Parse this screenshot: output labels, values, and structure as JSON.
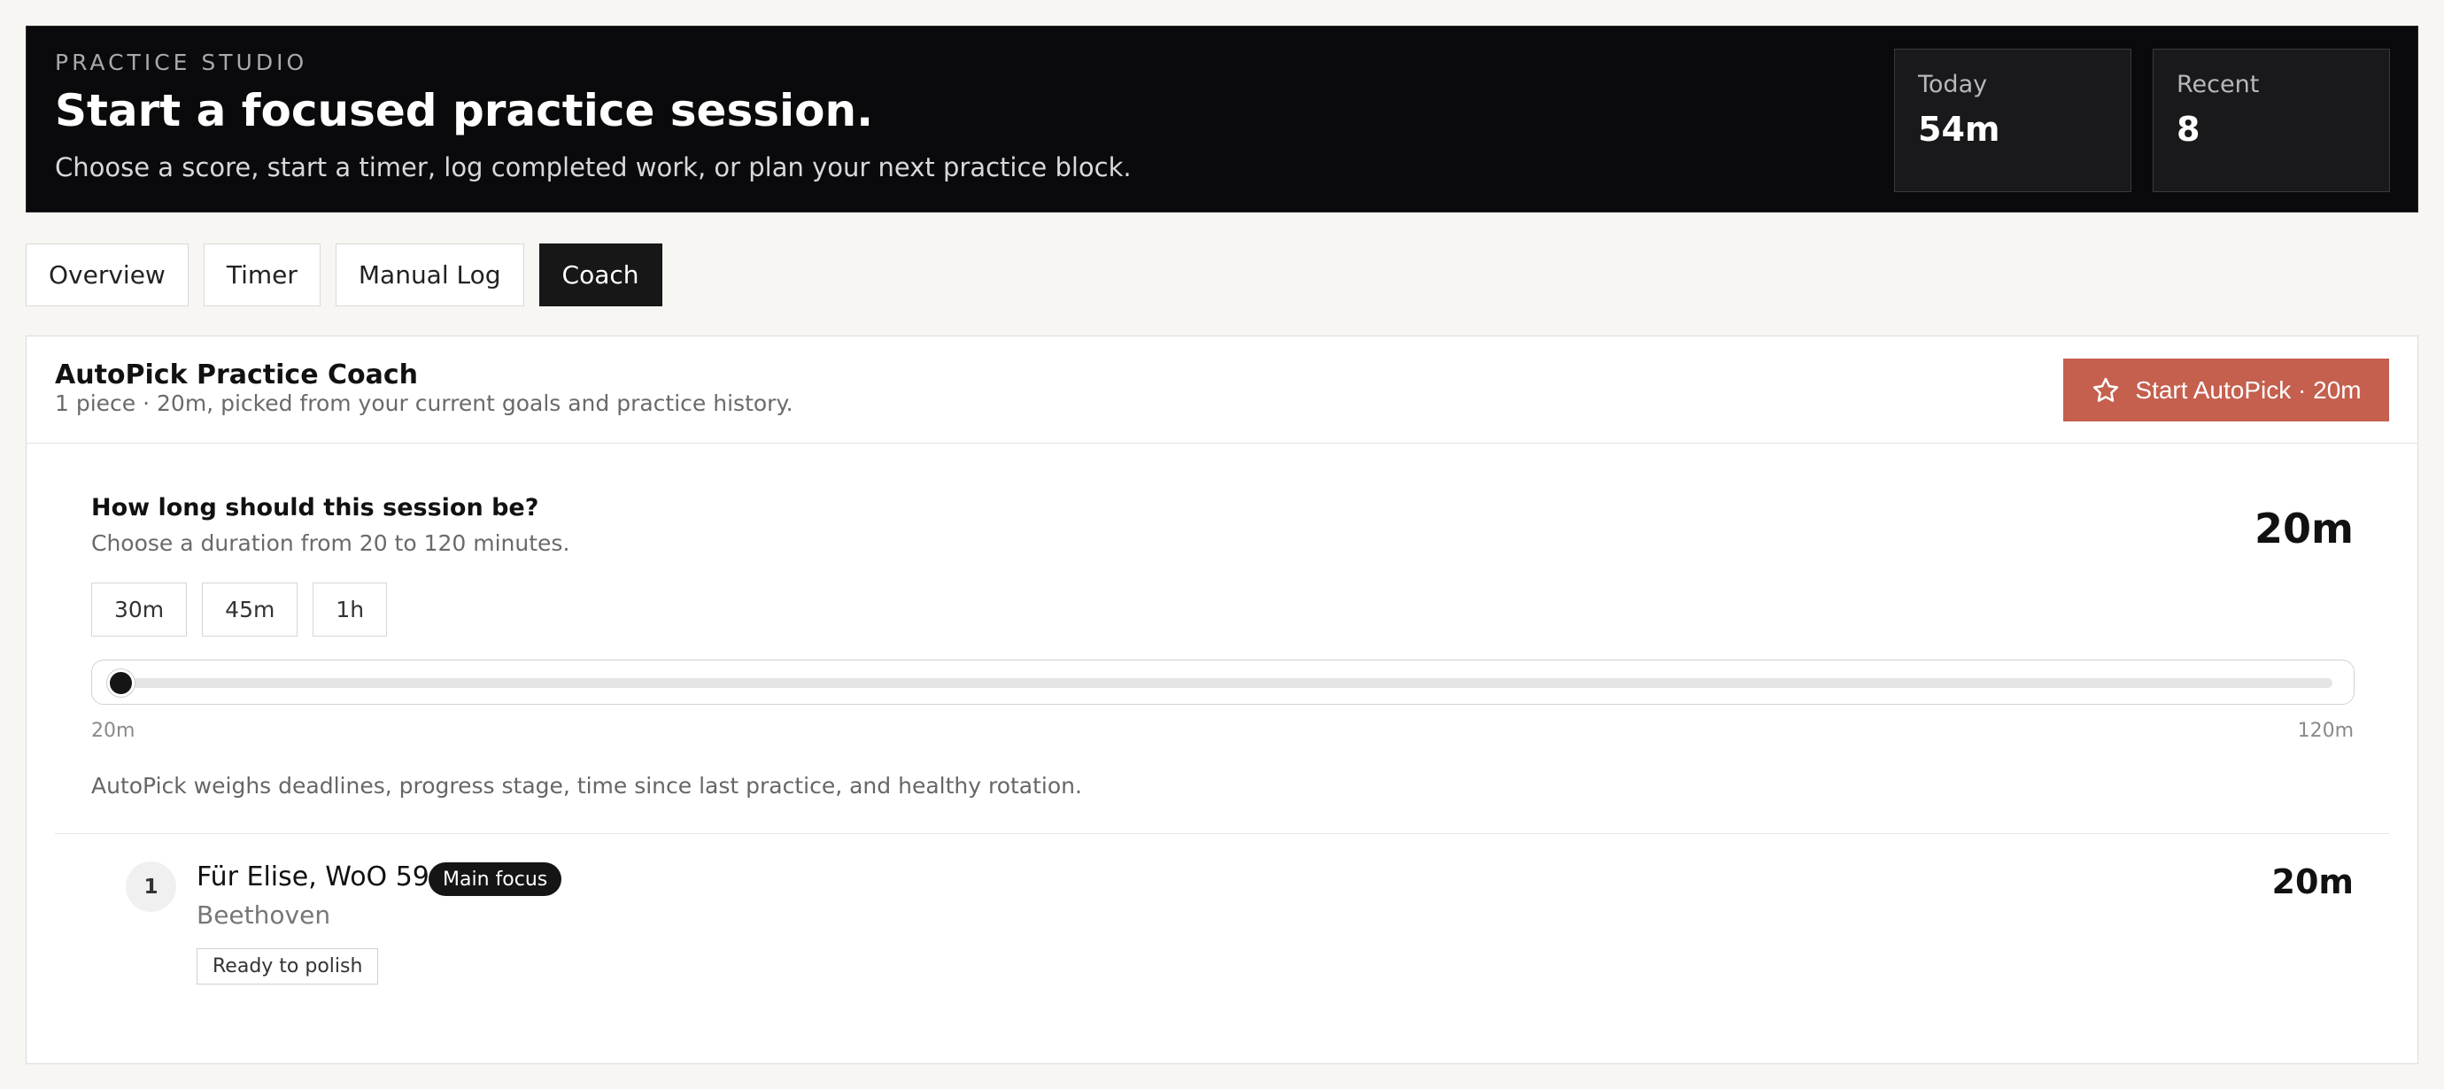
{
  "header": {
    "eyebrow": "PRACTICE STUDIO",
    "title": "Start a focused practice session.",
    "subtitle": "Choose a score, start a timer, log completed work, or plan your next practice block.",
    "stats": [
      {
        "label": "Today",
        "value": "54m"
      },
      {
        "label": "Recent",
        "value": "8"
      }
    ]
  },
  "tabs": [
    {
      "label": "Overview",
      "active": false
    },
    {
      "label": "Timer",
      "active": false
    },
    {
      "label": "Manual Log",
      "active": false
    },
    {
      "label": "Coach",
      "active": true
    }
  ],
  "coach": {
    "title": "AutoPick Practice Coach",
    "subtitle": "1 piece · 20m, picked from your current goals and practice history.",
    "start_button": {
      "label": "Start AutoPick · 20m",
      "icon": "star-icon",
      "color": "#c55f4e"
    },
    "question": "How long should this session be?",
    "question_hint": "Choose a duration from 20 to 120 minutes.",
    "duration_display": "20m",
    "presets": [
      "30m",
      "45m",
      "1h"
    ],
    "slider": {
      "min": 20,
      "max": 120,
      "value": 20,
      "min_label": "20m",
      "max_label": "120m"
    },
    "note": "AutoPick weighs deadlines, progress stage, time since last practice, and healthy rotation."
  },
  "plan": [
    {
      "rank": "1",
      "title": "Für Elise, WoO 59",
      "badge": "Main focus",
      "composer": "Beethoven",
      "stage": "Ready to polish",
      "minutes": "20m"
    }
  ]
}
